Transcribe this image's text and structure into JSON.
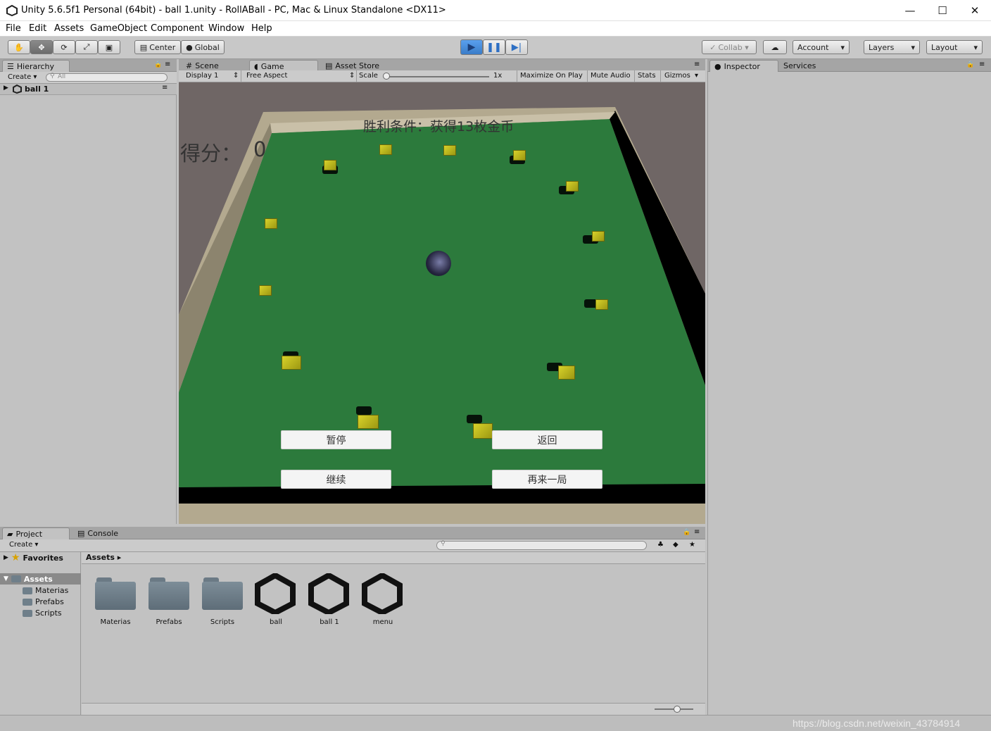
{
  "window": {
    "title": "Unity 5.6.5f1 Personal (64bit) - ball 1.unity - RollABall - PC, Mac & Linux Standalone <DX11>",
    "minimize": "—",
    "maximize": "☐",
    "close": "✕"
  },
  "menu": [
    "File",
    "Edit",
    "Assets",
    "GameObject",
    "Component",
    "Window",
    "Help"
  ],
  "toolbar": {
    "pivot": "Center",
    "space": "Global",
    "collab": "Collab ▾",
    "account": "Account",
    "layers": "Layers",
    "layout": "Layout",
    "dropdown_arrow": "▾"
  },
  "hierarchy": {
    "tab": "Hierarchy",
    "create": "Create ▾",
    "search_placeholder": "All",
    "scene": "ball 1"
  },
  "center_tabs": {
    "scene": "Scene",
    "game": "Game",
    "asset_store": "Asset Store"
  },
  "game_toolbar": {
    "display": "Display 1",
    "aspect": "Free Aspect",
    "scale_label": "Scale",
    "scale_value": "1x",
    "maximize": "Maximize On Play",
    "mute": "Mute Audio",
    "stats": "Stats",
    "gizmos": "Gizmos"
  },
  "game": {
    "win_condition": "胜利条件：获得13枚金币",
    "score_label": "得分：",
    "score_value": "0",
    "buttons": {
      "pause": "暂停",
      "back": "返回",
      "resume": "继续",
      "restart": "再来一局"
    }
  },
  "inspector": {
    "tab": "Inspector",
    "services": "Services"
  },
  "project": {
    "tab": "Project",
    "console": "Console",
    "create": "Create ▾",
    "favorites": "Favorites",
    "assets_root": "Assets",
    "breadcrumb": "Assets ▸",
    "tree_children": [
      "Materias",
      "Prefabs",
      "Scripts"
    ],
    "assets": [
      {
        "name": "Materias",
        "kind": "folder"
      },
      {
        "name": "Prefabs",
        "kind": "folder"
      },
      {
        "name": "Scripts",
        "kind": "folder"
      },
      {
        "name": "ball",
        "kind": "scene"
      },
      {
        "name": "ball 1",
        "kind": "scene"
      },
      {
        "name": "menu",
        "kind": "scene"
      }
    ]
  },
  "watermark": "https://blog.csdn.net/weixin_43784914",
  "colors": {
    "play_active": "#4a8fe0",
    "floor": "#2f7a3e",
    "wall": "#b8ad93",
    "coin": "#c8c21e"
  }
}
